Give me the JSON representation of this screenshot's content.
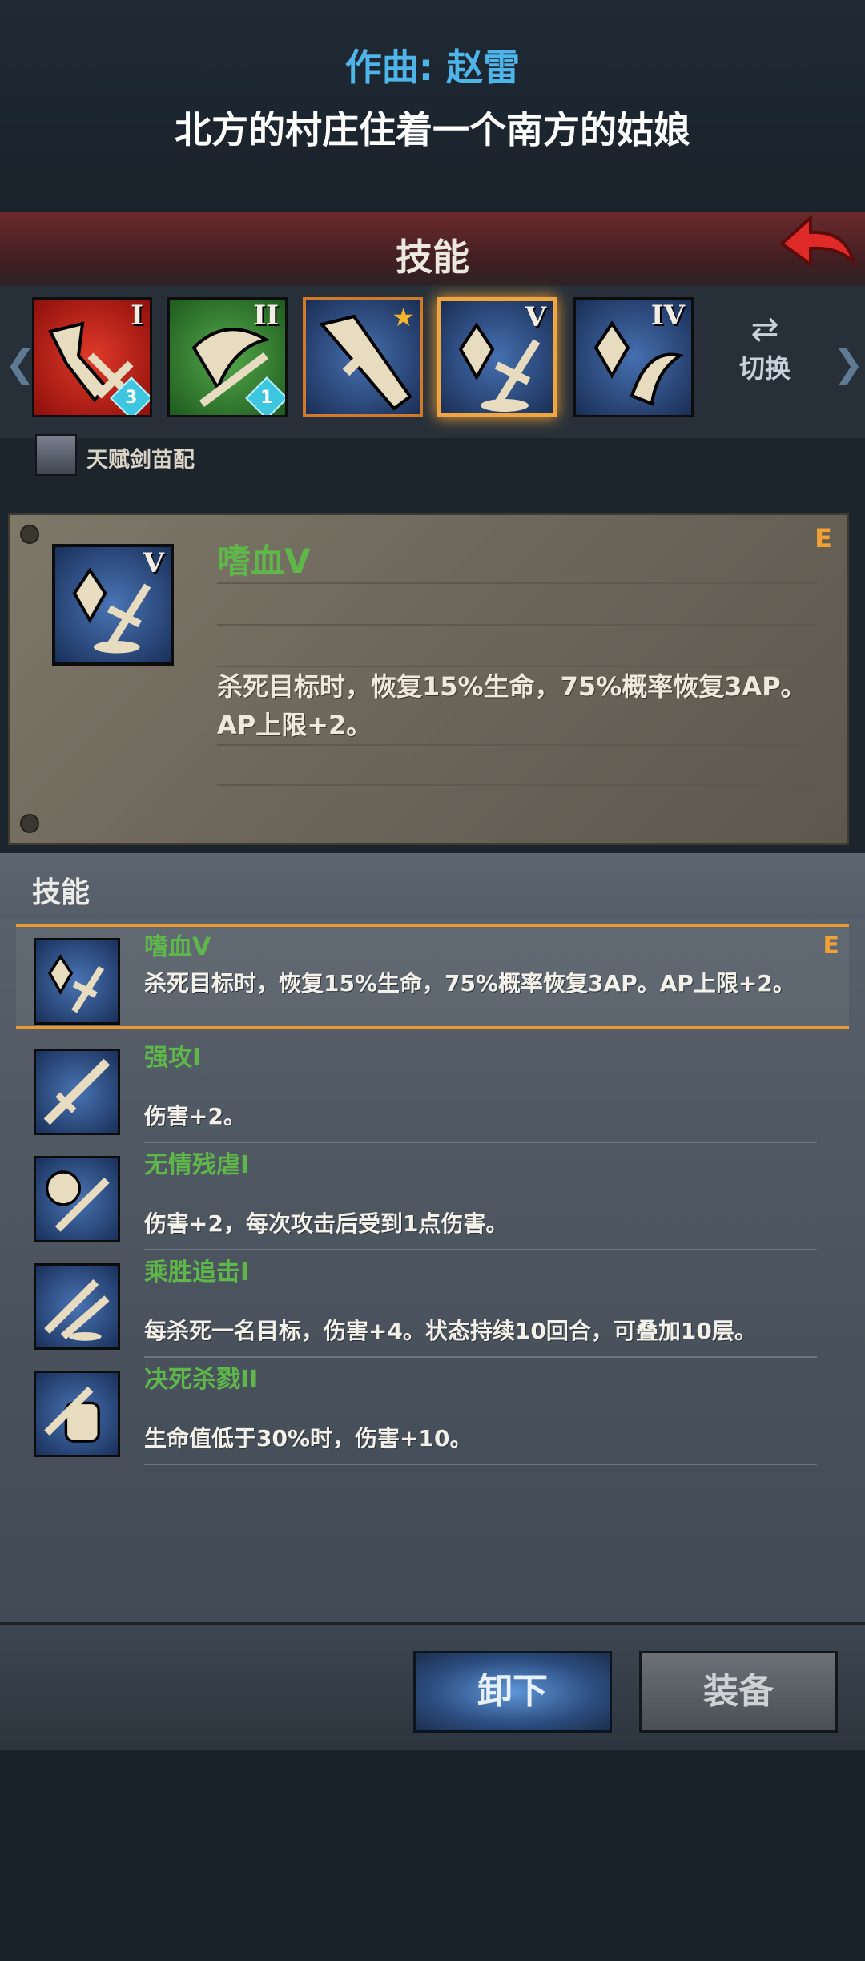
{
  "caption": {
    "line1": "作曲: 赵雷",
    "line2": "北方的村庄住着一个南方的姑娘"
  },
  "header": {
    "title": "技能",
    "back_icon": "back-arrow-icon"
  },
  "skill_slots": [
    {
      "roman": "I",
      "color": "red",
      "badge": "3"
    },
    {
      "roman": "II",
      "color": "green",
      "badge": "1"
    },
    {
      "roman": "",
      "color": "blue",
      "badge": "",
      "star": true
    },
    {
      "roman": "V",
      "color": "blue",
      "badge": "",
      "selected": true
    },
    {
      "roman": "IV",
      "color": "blue",
      "badge": ""
    }
  ],
  "switch": {
    "label": "切换",
    "icon": "swap-arrows-icon"
  },
  "talent": {
    "label": "天赋剑苗配"
  },
  "detail": {
    "name": "嗜血V",
    "roman": "V",
    "grade": "E",
    "description": "杀死目标时，恢复15%生命，75%概率恢复3AP。AP上限+2。"
  },
  "skill_list": {
    "header": "技能",
    "items": [
      {
        "name": "嗜血V",
        "desc": "杀死目标时，恢复15%生命，75%概率恢复3AP。AP上限+2。",
        "grade": "E",
        "selected": true
      },
      {
        "name": "强攻I",
        "desc": "伤害+2。",
        "grade": ""
      },
      {
        "name": "无情残虐I",
        "desc": "伤害+2，每次攻击后受到1点伤害。",
        "grade": ""
      },
      {
        "name": "乘胜追击I",
        "desc": "每杀死一名目标，伤害+4。状态持续10回合，可叠加10层。",
        "grade": ""
      },
      {
        "name": "决死杀戮II",
        "desc": "生命值低于30%时，伤害+10。",
        "grade": ""
      }
    ]
  },
  "buttons": {
    "unload": "卸下",
    "equip": "装备"
  },
  "colors": {
    "accent_orange": "#f0a035",
    "skill_name_green": "#5fb74a",
    "caption_blue": "#4fb4e8"
  }
}
